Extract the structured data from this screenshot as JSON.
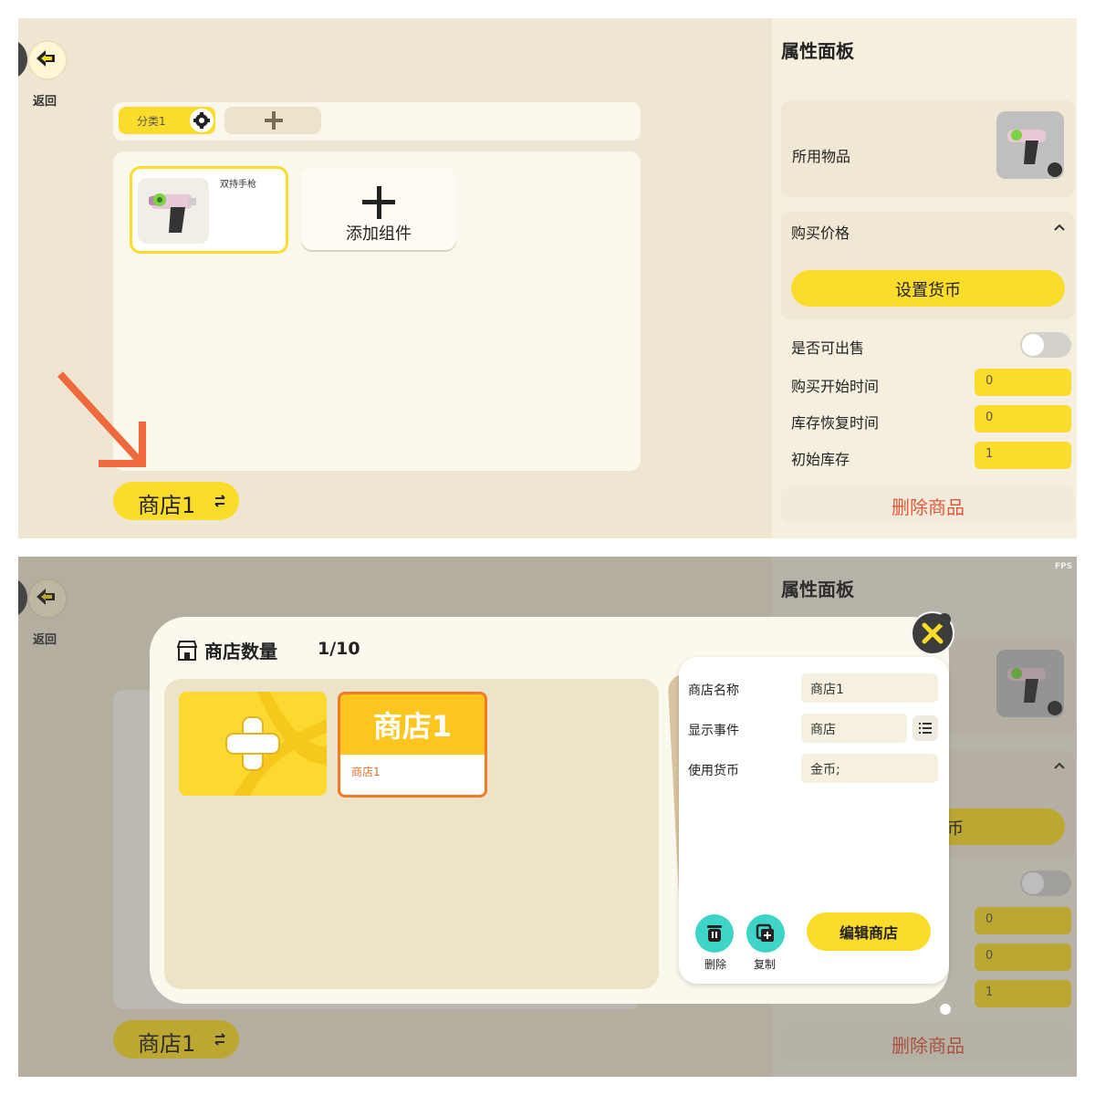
{
  "top": {
    "back_label": "返回",
    "category_tab": "分类1",
    "item_name": "双持手枪",
    "add_component_label": "添加组件",
    "shop_button_label": "商店1",
    "property_panel": {
      "title": "属性面板",
      "used_item_label": "所用物品",
      "buy_price_label": "购买价格",
      "set_currency_label": "设置货币",
      "can_sell_label": "是否可出售",
      "buy_start_time_label": "购买开始时间",
      "buy_start_time_value": "0",
      "stock_recover_label": "库存恢复时间",
      "stock_recover_value": "0",
      "initial_stock_label": "初始库存",
      "initial_stock_value": "1",
      "delete_label": "删除商品"
    }
  },
  "bottom": {
    "back_label": "返回",
    "fps_label": "FPS",
    "property_title": "属性面板",
    "currency_partial": "币",
    "values": [
      "0",
      "0",
      "1"
    ],
    "delete_label": "删除商品",
    "shop_button_label": "商店1",
    "dialog": {
      "title": "商店数量",
      "count": "1/10",
      "shop_card_title": "商店1",
      "shop_card_sub": "商店1",
      "detail": {
        "name_label": "商店名称",
        "name_value": "商店1",
        "event_label": "显示事件",
        "event_value": "商店",
        "currency_label": "使用货币",
        "currency_value": "金币;",
        "delete_label": "删除",
        "copy_label": "复制",
        "edit_label": "编辑商店"
      }
    }
  },
  "colors": {
    "accent_yellow": "#fcdc2a",
    "background": "#eee6d2",
    "danger": "#e05a3a",
    "teal": "#3fd4c8",
    "arrow": "#f0693c"
  }
}
